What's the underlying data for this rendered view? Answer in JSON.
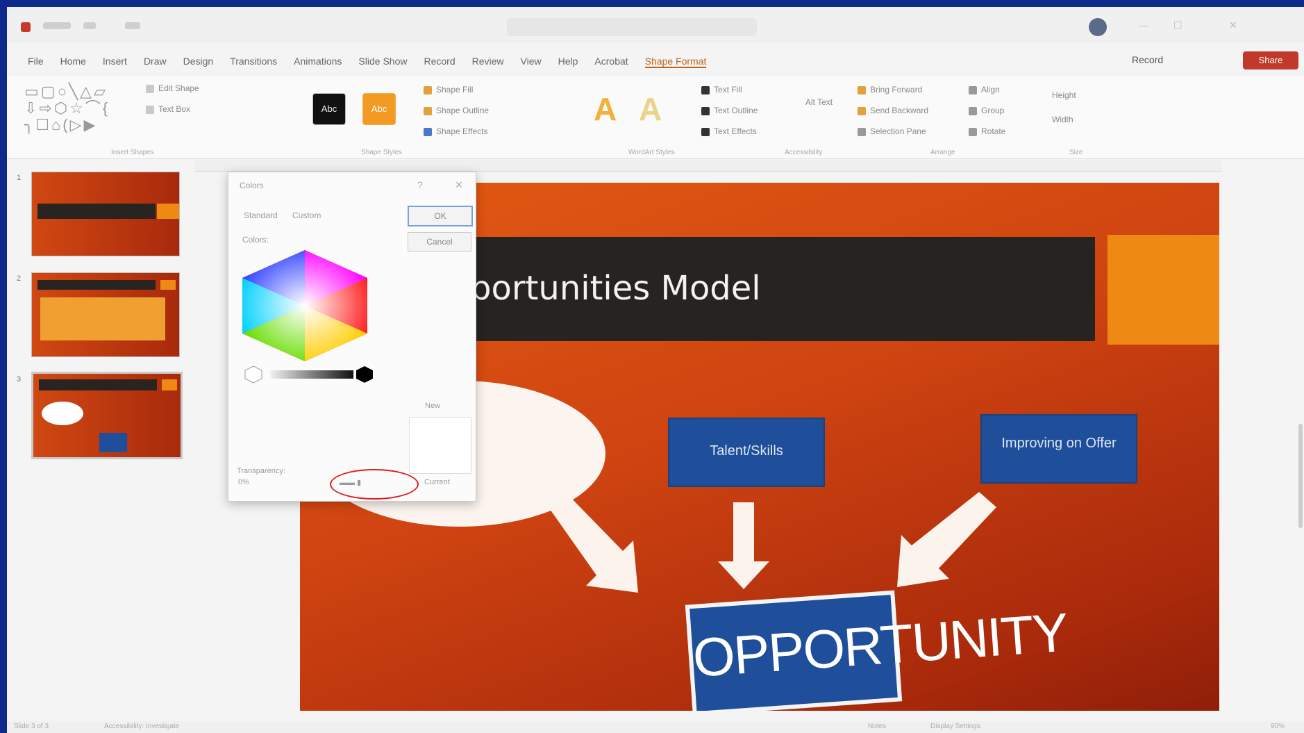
{
  "titlebar": {
    "doc_title": "",
    "search_placeholder": ""
  },
  "menu": {
    "tabs": [
      "File",
      "Home",
      "Insert",
      "Draw",
      "Design",
      "Transitions",
      "Animations",
      "Slide Show",
      "Record",
      "Review",
      "View",
      "Help",
      "Acrobat",
      "Shape Format"
    ],
    "active_tab": "Shape Format",
    "record_label": "Record",
    "share_label": "Share"
  },
  "ribbon": {
    "shape_fill_label": "Shape Fill",
    "shape_outline_label": "Shape Outline",
    "shape_effects_label": "Shape Effects",
    "edit_shape_label": "Edit Shape",
    "text_box_label": "Text Box",
    "text_fill_label": "Text Fill",
    "text_outline_label": "Text Outline",
    "text_effects_label": "Text Effects",
    "alt_text_label": "Alt Text",
    "bring_forward_label": "Bring Forward",
    "send_backward_label": "Send Backward",
    "selection_pane_label": "Selection Pane",
    "align_label": "Align",
    "group_label": "Group",
    "rotate_label": "Rotate",
    "height_label": "Height",
    "width_label": "Width",
    "style_swatch_dark": "Abc",
    "style_swatch_orange": "Abc",
    "wordart_a": "A",
    "group_labels": [
      "Insert Shapes",
      "Shape Styles",
      "WordArt Styles",
      "Accessibility",
      "Arrange",
      "Size"
    ]
  },
  "thumbnails": [
    {
      "num": "1"
    },
    {
      "num": "2"
    },
    {
      "num": "3"
    }
  ],
  "slide": {
    "title": "portunities Model",
    "box_left": "Talent/Skills",
    "box_right": "Improving on Offer",
    "center_label": "OPPORTUNITY"
  },
  "dialog": {
    "title": "Colors",
    "tab_standard": "Standard",
    "tab_custom": "Custom",
    "colors_label": "Colors:",
    "ok_label": "OK",
    "cancel_label": "Cancel",
    "new_label": "New",
    "current_label": "Current",
    "transparency_label": "Transparency:",
    "transparency_value": "0%"
  },
  "statusbar": {
    "slide_info": "Slide 3 of 3",
    "accessibility": "Accessibility: Investigate",
    "notes": "Notes",
    "display_settings": "Display Settings",
    "zoom": "90%"
  },
  "colors": {
    "frame_bg": "#0b2a8c",
    "accent": "#c0641a",
    "slide_title_bar": "#272320",
    "slide_orange_block": "#ee8a14",
    "box_blue": "#1f4e9a",
    "highlight_circle": "#e11d1d"
  }
}
